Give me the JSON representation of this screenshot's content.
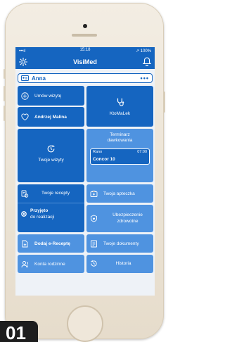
{
  "status_bar": {
    "signal": "•••ıl",
    "time": "15:18",
    "battery": "↗ 100%"
  },
  "header": {
    "title": "VisiMed"
  },
  "profile": {
    "name": "Anna",
    "menu": "•••"
  },
  "tiles": {
    "book_visit": "Umów wizytę",
    "doctor": "Andrzej Malina",
    "who_treats": "KtoMaLek",
    "your_visits": "Twoje wizyty",
    "schedule_title": "Terminarz\ndawkowania",
    "schedule_time_of_day": "Rano",
    "schedule_hour": "07:00",
    "schedule_drug": "Concor 10",
    "your_prescriptions": "Twoje recepty",
    "accepted": "Przyjęto",
    "accepted_sub": "do realizacji",
    "your_pharmacy": "Twoja apteczka",
    "insurance": "Ubezpieczenie\nzdrowotne",
    "add_eprescription": "Dodaj e-Receptę",
    "your_documents": "Twoje dokumenty",
    "family_accounts": "Konta rodzinne",
    "history": "Historia"
  },
  "badge": "01",
  "colors": {
    "primary": "#1565c0",
    "light": "#4f93e0",
    "background": "#eef2f7",
    "phone_body": "#f3ede3"
  }
}
